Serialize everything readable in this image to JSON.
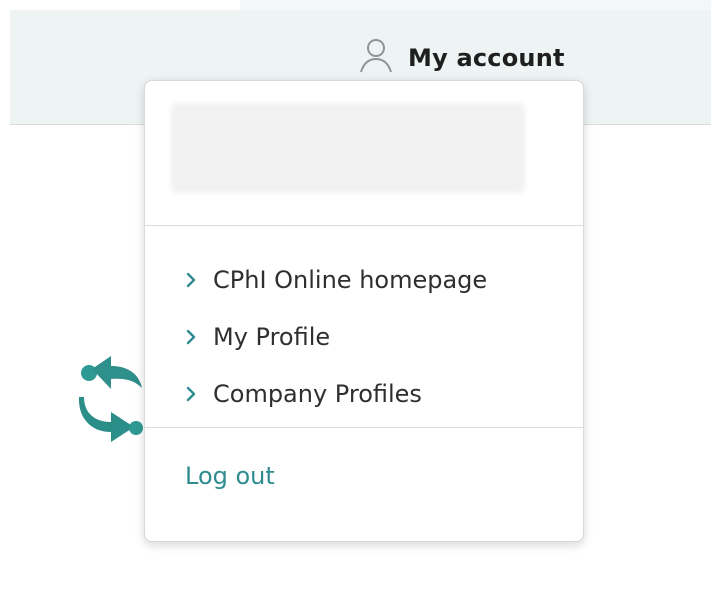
{
  "colors": {
    "header_bg": "#eef3f3",
    "dropdown_bg": "#ffffff",
    "text_primary": "#2f2f2f",
    "accent_teal": "#2e8c91",
    "divider": "#dcdcdc"
  },
  "header": {
    "account_label": "My account",
    "account_icon": "user-icon"
  },
  "dropdown": {
    "menu_items": [
      {
        "label": "CPhI Online homepage",
        "icon": "chevron-right-icon"
      },
      {
        "label": "My Profile",
        "icon": "chevron-right-icon"
      },
      {
        "label": "Company Profiles",
        "icon": "chevron-right-icon"
      }
    ],
    "logout_label": "Log out"
  },
  "background": {
    "sync_icon": "sync-arrows-icon"
  }
}
